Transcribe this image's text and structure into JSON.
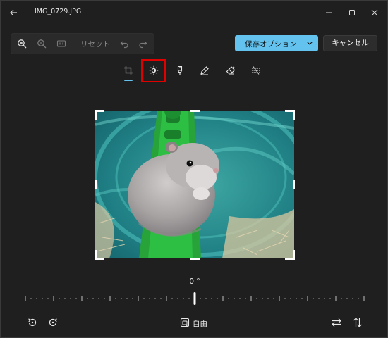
{
  "window": {
    "title": "IMG_0729.JPG"
  },
  "toolbar": {
    "reset_label": "リセット"
  },
  "actions": {
    "save_label": "保存オプション",
    "cancel_label": "キャンセル"
  },
  "straighten": {
    "angle_label": "0 °"
  },
  "aspect": {
    "label": "自由"
  },
  "colors": {
    "accent": "#63c3ee",
    "highlight": "#e00000",
    "background": "#1f1f1f"
  },
  "icons": [
    "back-arrow-icon",
    "minimize-icon",
    "maximize-icon",
    "close-icon",
    "zoom-in-icon",
    "zoom-out-icon",
    "actual-size-icon",
    "undo-icon",
    "redo-icon",
    "crop-icon",
    "brightness-icon",
    "filter-icon",
    "markup-icon",
    "erase-icon",
    "background-blur-icon",
    "rotate-left-icon",
    "rotate-right-icon",
    "flip-horizontal-icon",
    "flip-vertical-icon",
    "aspect-ratio-icon"
  ]
}
